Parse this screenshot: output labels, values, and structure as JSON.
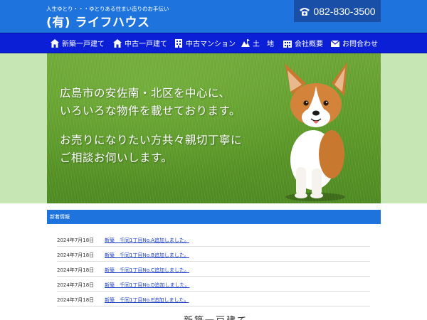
{
  "header": {
    "tagline": "人生ゆとり・・・ゆとりある住まい造りのお手伝い",
    "logo": "(有) ライフハウス",
    "phone": "082-830-3500",
    "phone_icon": "telephone-icon"
  },
  "colors": {
    "header_blue": "#1e73dc",
    "phone_box": "#1a4fa8",
    "nav_blue": "#0a1fd6",
    "hero_side": "#c6e6b3",
    "link": "#1a3cc8"
  },
  "nav": {
    "items": [
      {
        "label": "新築一戸建て",
        "icon": "house-icon"
      },
      {
        "label": "中古一戸建て",
        "icon": "house-icon"
      },
      {
        "label": "中古マンション",
        "icon": "building-icon"
      },
      {
        "label": "土　地",
        "icon": "land-icon"
      },
      {
        "label": "会社概要",
        "icon": "office-icon"
      },
      {
        "label": "お問合わせ",
        "icon": "mail-icon"
      }
    ]
  },
  "hero": {
    "lines": [
      "広島市の安佐南・北区を中心に、",
      "いろいろな物件を載せております。",
      "お売りになりたい方共々親切丁寧に",
      "ご相談お伺いします。"
    ]
  },
  "news": {
    "heading": "新着情報",
    "items": [
      {
        "date": "2024年7月18日",
        "text": "新築　千同1丁目No.A追加しました。"
      },
      {
        "date": "2024年7月18日",
        "text": "新築　千同1丁目No.B追加しました。"
      },
      {
        "date": "2024年7月18日",
        "text": "新築　千同1丁目No.C追加しました。"
      },
      {
        "date": "2024年7月18日",
        "text": "新築　千同1丁目No.D追加しました。"
      },
      {
        "date": "2024年7月18日",
        "text": "新築　千同1丁目No.E追加しました。"
      }
    ]
  },
  "section": {
    "title": "新築一戸建て"
  }
}
